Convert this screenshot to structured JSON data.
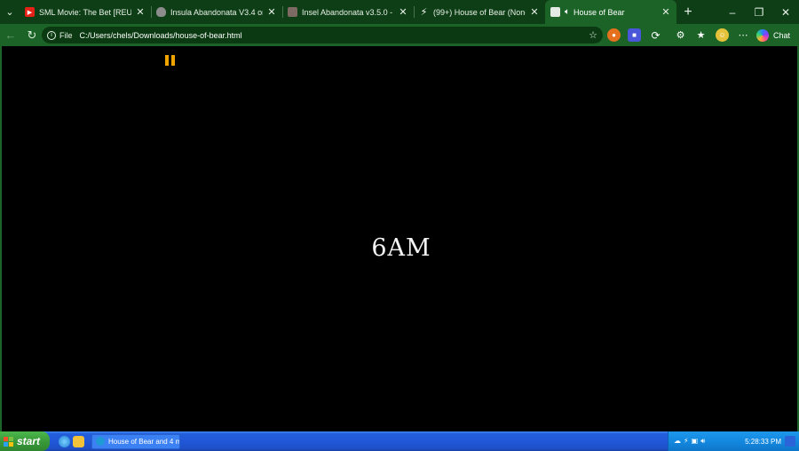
{
  "browser": {
    "tabs": [
      {
        "title": "SML Movie: The Bet [REUPLOAD",
        "icon": "youtube-icon",
        "active": false
      },
      {
        "title": "Insula Abandonata V3.4 on Scr",
        "icon": "page-icon",
        "active": false
      },
      {
        "title": "Insel Abandonata v3.5.0 - Turb",
        "icon": "turbowarp-icon",
        "active": false
      },
      {
        "title": "(99+) House of Bear (Non-prof",
        "icon": "bolt-icon",
        "active": false
      },
      {
        "title": "House of Bear",
        "icon": "page-icon",
        "active": true
      }
    ],
    "address": {
      "scheme": "File",
      "url": "C:/Users/chels/Downloads/house-of-bear.html"
    },
    "chat_label": "Chat",
    "accent_color": "#1c6328"
  },
  "page": {
    "clock_text": "6AM",
    "pause_color": "#f0a400"
  },
  "taskbar": {
    "start_label": "start",
    "task_label": "House of Bear and 4 m...",
    "time": "5:28:33 PM"
  }
}
